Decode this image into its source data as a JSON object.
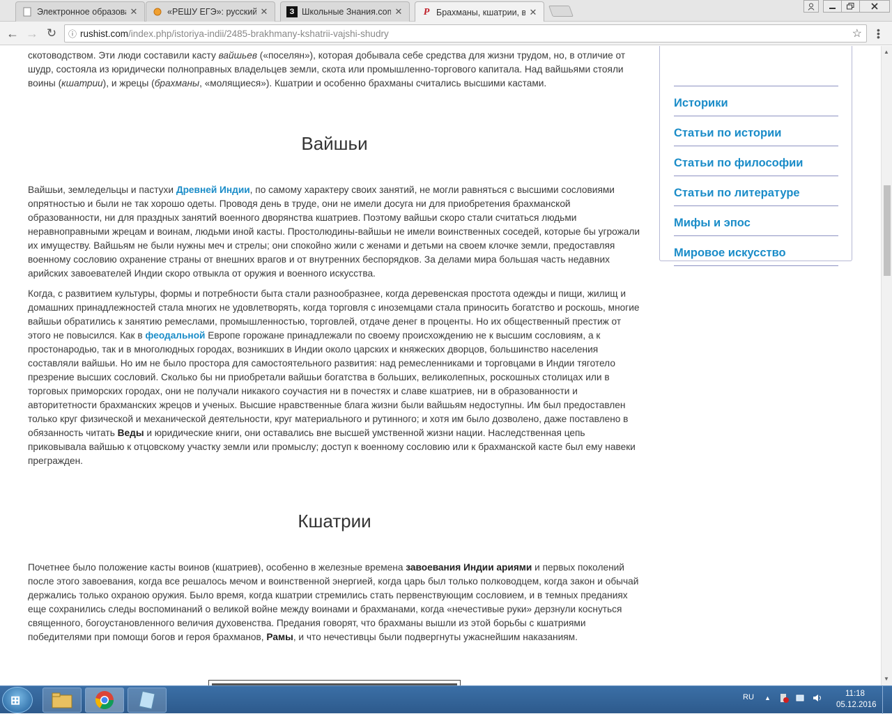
{
  "browser": {
    "tabs": [
      {
        "title": "Электронное образован",
        "favicon": "document-icon"
      },
      {
        "title": "«РЕШУ ЕГЭ»: русский язы",
        "favicon": "sun-icon"
      },
      {
        "title": "Школьные Знания.com",
        "favicon": "znanija-logo",
        "favicon_text": "З"
      },
      {
        "title": "Брахманы, кшатрии, вай",
        "favicon": "rushist-logo",
        "favicon_text": "P"
      }
    ],
    "active_tab": 3,
    "url_domain": "rushist.com",
    "url_path": "/index.php/istoriya-indii/2485-brakhmany-kshatrii-vajshi-shudry"
  },
  "article": {
    "intro_lines": [
      "скотоводством. Эти люди составили касту ",
      "вайшьев",
      " («поселян»), которая добывала себе средства для жизни трудом, но, в отличие от шудр, состояла из юридически полноправных владельцев земли, скота или промышленно-торгового капитала. Над вайшьями стояли воины (",
      "кшатрии",
      "), и жрецы (",
      "брахманы",
      ", «молящиеся»). Кшатрии и особенно брахманы считались высшими кастами."
    ],
    "section1_title": "Вайшьи",
    "s1p1": [
      "Вайшьи, земледельцы и пастухи ",
      "Древней Индии",
      ", по самому характеру своих занятий, не могли равняться с высшими сословиями опрятностью и были не так хорошо одеты. Проводя день в труде, они не имели досуга ни для приобретения брахманской образованности, ни для праздных занятий военного дворянства кшатриев. Поэтому вайшьи скоро стали считаться людьми неравноправными жрецам и воинам, людьми иной касты. Простолюдины-вайшьи не имели воинственных соседей, которые бы угрожали их имуществу. Вайшьям не были нужны меч и стрелы; они спокойно жили с женами и детьми на своем клочке земли, предоставляя военному сословию охранение страны от внешних врагов и от внутренних беспорядков. За делами мира большая часть недавних арийских завоевателей Индии скоро отвыкла от оружия и военного искусства."
    ],
    "s1p2": [
      "Когда, с развитием культуры, формы и потребности быта стали разнообразнее, когда деревенская простота одежды и пищи, жилищ и домашних принадлежностей стала многих не удовлетворять, когда торговля с иноземцами стала приносить богатство и роскошь, многие вайшьи обратились к занятию ремеслами, промышленностью, торговлей, отдаче денег в проценты. Но их общественный престиж от этого не повысился. Как в ",
      "феодальной",
      " Европе горожане принадлежали по своему происхождению не к высшим сословиям, а к простонародью, так и в многолюдных городах, возникших в Индии около царских и княжеских дворцов, большинство населения составляли вайшьи. Но им не было простора для самостоятельного развития: над ремесленниками и торговцами в Индии тяготело презрение высших сословий. Сколько бы ни приобретали вайшьи богатства в больших, великолепных, роскошных столицах или в торговых приморских городах, они не получали никакого соучастия ни в почестях и славе кшатриев, ни в образованности и авторитетности брахманских жрецов и ученых. Высшие нравственные блага жизни были вайшьям недоступны. Им был предоставлен только круг физической и механической деятельности, круг материального и рутинного; и хотя им было дозволено, даже поставлено в обязанность читать ",
      "Веды",
      " и юридические книги, они оставались вне высшей умственной жизни нации. Наследственная цепь приковывала вайшью к отцовскому участку земли или промыслу; доступ к военному сословию или к брахманской касте был ему навеки прегражден."
    ],
    "section2_title": "Кшатрии",
    "s2p1": [
      "Почетнее было положение касты воинов (кшатриев), особенно в железные времена ",
      "завоевания Индии ариями",
      " и первых поколений после этого завоевания, когда все решалось мечом и воинственной энергией, когда царь был только полководцем, когда закон и обычай держались только охраною оружия. Было время, когда кшатрии стремились стать первенствующим сословием, и в темных преданиях еще сохранились следы воспоминаний о великой войне между воинами и брахманами, когда «нечестивые руки» дерзнули коснуться священного, богоустановленного величия духовенства. Предания говорят, что брахманы вышли из этой борьбы с кшатриями победителями при помощи богов и героя брахманов, ",
      "Рамы",
      ", и что нечестивцы были подвергнуты ужаснейшим наказаниям."
    ]
  },
  "sidebar": {
    "items": [
      "Историки",
      "Статьи по истории",
      "Статьи по философии",
      "Статьи по литературе",
      "Мифы и эпос",
      "Мировое искусство"
    ]
  },
  "taskbar": {
    "language": "RU",
    "time": "11:18",
    "date": "05.12.2016"
  }
}
